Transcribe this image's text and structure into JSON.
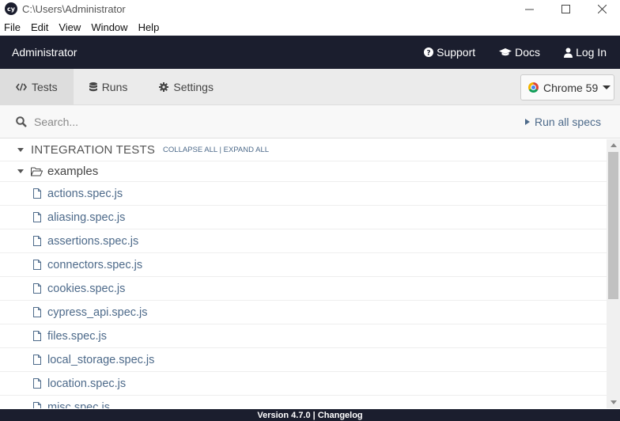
{
  "window": {
    "title": "C:\\Users\\Administrator",
    "app_icon_text": "cy"
  },
  "menu": [
    "File",
    "Edit",
    "View",
    "Window",
    "Help"
  ],
  "header": {
    "user": "Administrator",
    "support": "Support",
    "docs": "Docs",
    "login": "Log In"
  },
  "nav": {
    "tabs": [
      {
        "label": "Tests",
        "icon": "code-icon",
        "active": true
      },
      {
        "label": "Runs",
        "icon": "database-icon",
        "active": false
      },
      {
        "label": "Settings",
        "icon": "gear-icon",
        "active": false
      }
    ],
    "browser": "Chrome 59"
  },
  "search": {
    "placeholder": "Search...",
    "run_all": "Run all specs"
  },
  "specs": {
    "section_title": "INTEGRATION TESTS",
    "collapse_all": "COLLAPSE ALL",
    "separator": "|",
    "expand_all": "EXPAND ALL",
    "folder": "examples",
    "files": [
      "actions.spec.js",
      "aliasing.spec.js",
      "assertions.spec.js",
      "connectors.spec.js",
      "cookies.spec.js",
      "cypress_api.spec.js",
      "files.spec.js",
      "local_storage.spec.js",
      "location.spec.js",
      "misc.spec.js"
    ]
  },
  "footer": {
    "version": "Version 4.7.0",
    "separator": "|",
    "changelog": "Changelog"
  },
  "colors": {
    "header_bg": "#1b1e2e",
    "link": "#4d6a8a",
    "nav_bg": "#ebebeb"
  }
}
